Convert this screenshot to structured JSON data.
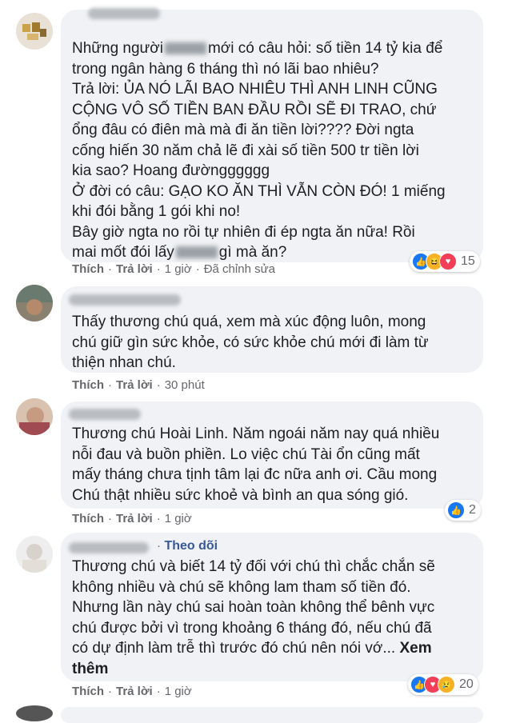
{
  "colors": {
    "bubble": "#f0f2f5",
    "meta": "#65676b",
    "link": "#385898",
    "like": "#1877f2",
    "love": "#f33e58",
    "haha": "#f7b125"
  },
  "comments": [
    {
      "lines_a": "Những người",
      "lines_b": "mới có câu hỏi: số tiền 14 tỷ kia để\ntrong ngân hàng 6 tháng thì nó lãi bao nhiêu?\nTrả lời: ỦA NÓ LÃI BAO NHIÊU THÌ ANH LINH CŨNG\nCỘNG VÔ SỐ TIỀN BAN ĐẦU RỒI SẼ ĐI TRAO, chứ\nổng đâu có điên mà mà đi ăn tiền lời???? Đời ngta\ncống hiến 30 năm chả lẽ đi xài số tiền 500 tr tiền lời\nkia sao? Hoang đườngggggg\nỞ đời có câu: GẠO KO ĂN THÌ VẪN CÒN ĐÓ! 1 miếng\nkhi đói bằng 1 gói khi no!\nBây giờ ngta no rồi tự nhiên đi ép ngta ăn nữa! Rồi\nmai mốt đói lấy",
      "lines_c": "gì mà ăn?",
      "like": "Thích",
      "reply": "Trả lời",
      "time": "1 giờ",
      "edited": "Đã chỉnh sửa",
      "reactions": [
        "like",
        "haha",
        "love"
      ],
      "count": "15"
    },
    {
      "text": "Thấy thương chú quá, xem mà xúc động luôn, mong\nchú giữ gìn sức khỏe, có sức khỏe chú mới đi làm từ\nthiện nhan chú.",
      "like": "Thích",
      "reply": "Trả lời",
      "time": "30 phút"
    },
    {
      "text": "Thương chú Hoài Linh. Năm ngoái năm nay quá nhiều\nnỗi đau và buồn phiền. Lo việc chú Tài ổn cũng mất\nmấy tháng chưa tịnh tâm lại đc nữa anh ơi. Cầu mong\nChú thật nhiều sức khoẻ và bình an qua sóng gió.",
      "like": "Thích",
      "reply": "Trả lời",
      "time": "1 giờ",
      "reactions": [
        "like"
      ],
      "count": "2"
    },
    {
      "follow": "Theo dõi",
      "text": "Thương chú và biết 14 tỷ đối với chú thì chắc chắn sẽ\nkhông nhiều và chú sẽ không lam tham số tiền đó.\nNhưng lần này chú sai hoàn toàn không thể bênh vực\nchú được bởi vì trong khoảng 6 tháng đó, nếu chú đã\ncó dự định làm trễ thì trước đó chú nên nói vớ...",
      "see_more": "Xem\nthêm",
      "like": "Thích",
      "reply": "Trả lời",
      "time": "1 giờ",
      "reactions": [
        "like",
        "love",
        "sad"
      ],
      "count": "20"
    }
  ]
}
